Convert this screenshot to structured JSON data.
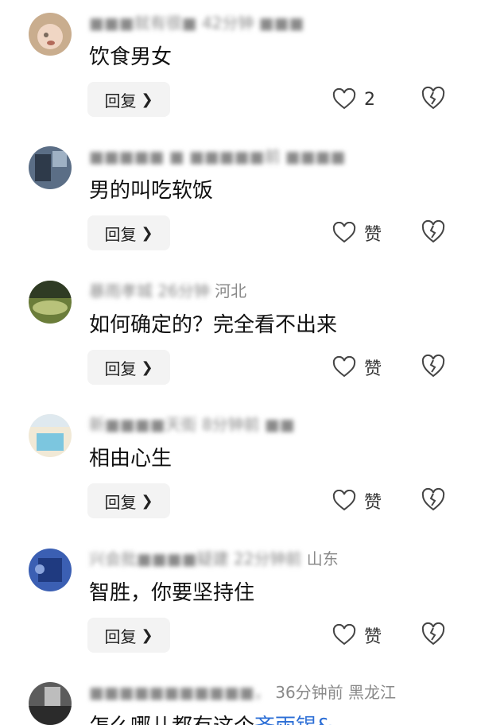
{
  "comments": [
    {
      "meta_blurred": "■■■就有很■ 42分钟 ■■■",
      "meta_clear": "",
      "text": "饮食男女",
      "link_text": "",
      "reply_label": "回复",
      "like_label": "2",
      "avatar_colors": [
        "#c9ad8e",
        "#f0d6c4",
        "#7a6a5d"
      ]
    },
    {
      "meta_blurred": "■■■■■ ■ ■■■■■前 ■■■■",
      "meta_clear": "",
      "text": "男的叫吃软饭",
      "link_text": "",
      "reply_label": "回复",
      "like_label": "赞",
      "avatar_colors": [
        "#5b6e86",
        "#2e3a4a",
        "#9fb1c4"
      ]
    },
    {
      "meta_blurred": "暴雨孝城 26分钟",
      "meta_clear": "河北",
      "text": "如何确定的？完全看不出来",
      "link_text": "",
      "reply_label": "回复",
      "like_label": "赞",
      "avatar_colors": [
        "#6b7d3a",
        "#2f3b24",
        "#b8c27a"
      ]
    },
    {
      "meta_blurred": "新■■■■天街 8分钟前 ■■",
      "meta_clear": "",
      "text": "相由心生",
      "link_text": "",
      "reply_label": "回复",
      "like_label": "赞",
      "avatar_colors": [
        "#f1e9d6",
        "#7cc6df",
        "#dfe9ef"
      ]
    },
    {
      "meta_blurred": "兴会批■■■■疑建 22分钟前",
      "meta_clear": "山东",
      "text": "智胜，你要坚持住",
      "link_text": "",
      "reply_label": "回复",
      "like_label": "赞",
      "avatar_colors": [
        "#3b5fb3",
        "#1f3a80",
        "#8aa4dd"
      ]
    },
    {
      "meta_blurred": "■■■■■■■■■■■，",
      "meta_clear": "36分钟前  黑龙江",
      "text": "怎么哪儿都有这个",
      "link_text": "齐雨锡&",
      "reply_label": "回复",
      "like_label": "赞",
      "avatar_colors": [
        "#5c5c5c",
        "#bdbdbd",
        "#2b2b2b"
      ]
    }
  ],
  "icons": {
    "like": "heart-outline-icon",
    "dislike": "broken-heart-icon",
    "reply": "chevron-right-icon"
  }
}
